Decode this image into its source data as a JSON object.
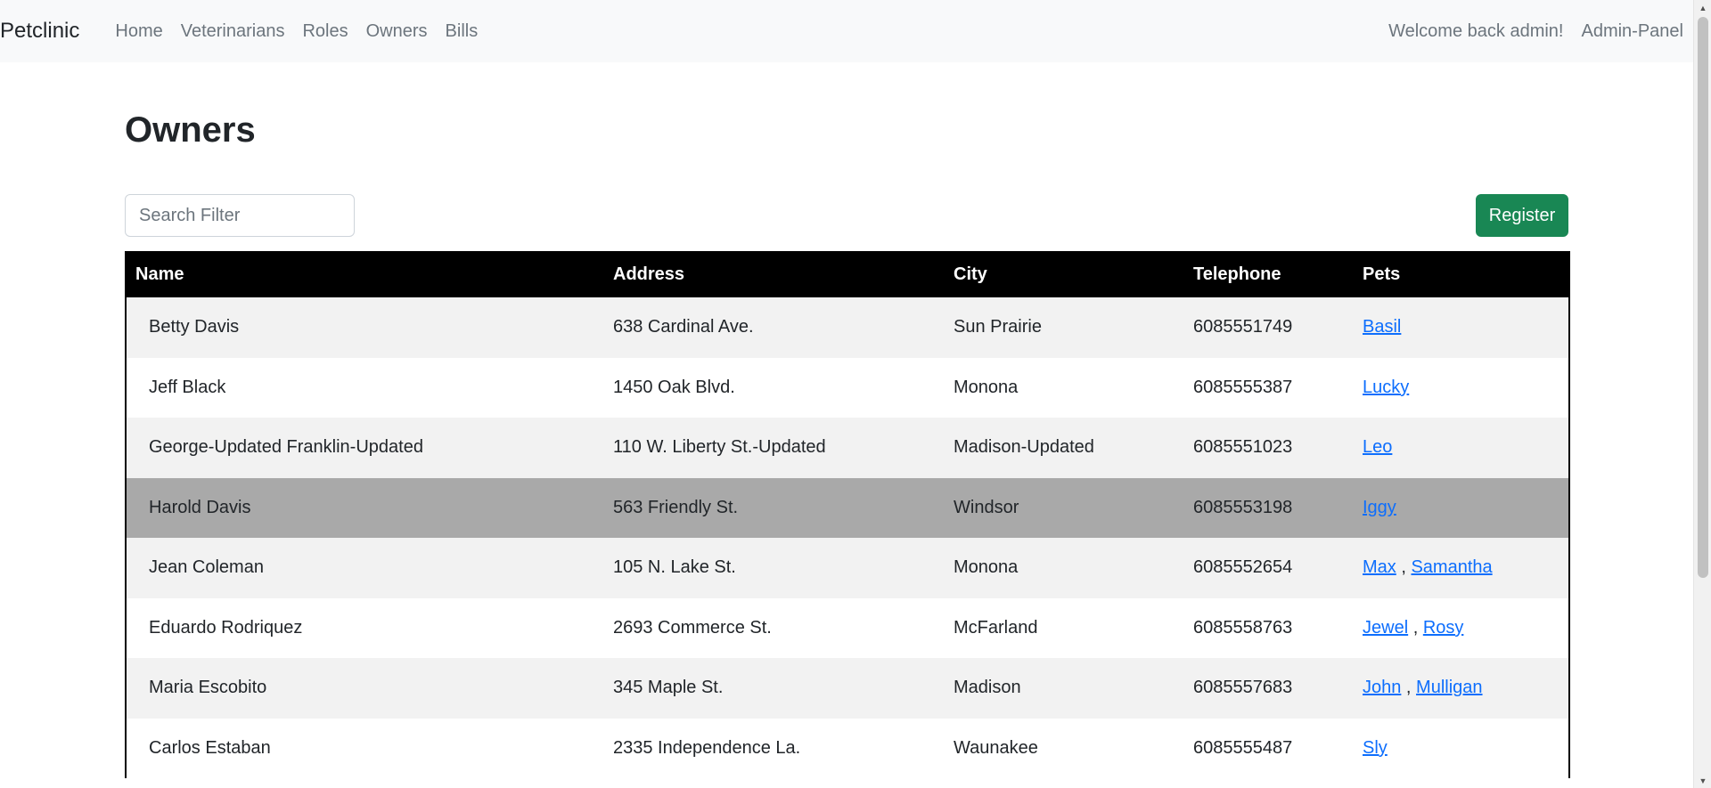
{
  "navbar": {
    "brand": "Petclinic",
    "links": [
      "Home",
      "Veterinarians",
      "Roles",
      "Owners",
      "Bills"
    ],
    "welcome": "Welcome back admin!",
    "admin": "Admin-Panel"
  },
  "page": {
    "title": "Owners",
    "search_placeholder": "Search Filter",
    "register_label": "Register"
  },
  "table": {
    "headers": [
      "Name",
      "Address",
      "City",
      "Telephone",
      "Pets"
    ],
    "rows": [
      {
        "name": "Betty Davis",
        "address": "638 Cardinal Ave.",
        "city": "Sun Prairie",
        "telephone": "6085551749",
        "pets": [
          "Basil"
        ]
      },
      {
        "name": "Jeff Black",
        "address": "1450 Oak Blvd.",
        "city": "Monona",
        "telephone": "6085555387",
        "pets": [
          "Lucky"
        ]
      },
      {
        "name": "George-Updated Franklin-Updated",
        "address": "110 W. Liberty St.-Updated",
        "city": "Madison-Updated",
        "telephone": "6085551023",
        "pets": [
          "Leo"
        ]
      },
      {
        "name": "Harold Davis",
        "address": "563 Friendly St.",
        "city": "Windsor",
        "telephone": "6085553198",
        "pets": [
          "Iggy"
        ],
        "hovered": true
      },
      {
        "name": "Jean Coleman",
        "address": "105 N. Lake St.",
        "city": "Monona",
        "telephone": "6085552654",
        "pets": [
          "Max",
          "Samantha"
        ]
      },
      {
        "name": "Eduardo Rodriquez",
        "address": "2693 Commerce St.",
        "city": "McFarland",
        "telephone": "6085558763",
        "pets": [
          "Jewel",
          "Rosy"
        ]
      },
      {
        "name": "Maria Escobito",
        "address": "345 Maple St.",
        "city": "Madison",
        "telephone": "6085557683",
        "pets": [
          "John",
          "Mulligan"
        ]
      },
      {
        "name": "Carlos Estaban",
        "address": "2335 Independence La.",
        "city": "Waunakee",
        "telephone": "6085555487",
        "pets": [
          "Sly"
        ]
      }
    ]
  },
  "colors": {
    "register_bg": "#198754",
    "header_bg": "#000000",
    "row_alt": "#f2f2f2",
    "row_hover": "#a9a9a9",
    "link": "#0d6efd"
  },
  "icons": {
    "scroll_up": "scroll-up-arrow-icon",
    "scroll_down": "scroll-down-arrow-icon"
  }
}
